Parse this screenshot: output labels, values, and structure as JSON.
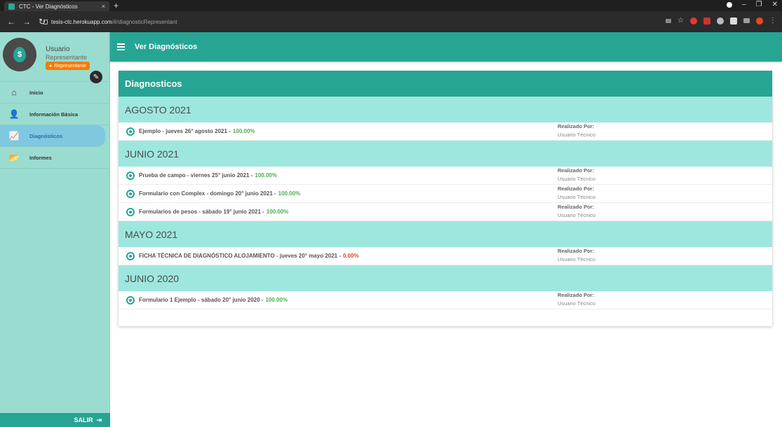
{
  "browser": {
    "tab_title": "CTC - Ver Diagnósticos",
    "tab_close": "×",
    "new_tab": "+",
    "url_host": "tesis-ctc.herokuapp.com",
    "url_path": "/#/diagnosticRepresentant"
  },
  "profile": {
    "name": "Usuario",
    "role": "Representante",
    "badge": "Representante"
  },
  "sidebar": {
    "items": [
      {
        "label": "Inicio",
        "icon": "home-icon",
        "glyph": "⌂"
      },
      {
        "label": "Información Básica",
        "icon": "user-add-icon",
        "glyph": "👤"
      },
      {
        "label": "Diagnósticos",
        "icon": "diagnostic-chart-icon",
        "glyph": "📈"
      },
      {
        "label": "Informes",
        "icon": "folder-open-icon",
        "glyph": "📂"
      }
    ],
    "logout_label": "SALIR"
  },
  "appbar": {
    "title": "Ver Diagnósticos"
  },
  "card": {
    "title": "Diagnosticos"
  },
  "groups": [
    {
      "month": "AGOSTO 2021",
      "items": [
        {
          "title": "Ejemplo - jueves 26° agosto 2021 -",
          "percent": "100.00%",
          "status": "ok",
          "by_label": "Realizado Por:",
          "by_value": "Usuario Técnico"
        }
      ]
    },
    {
      "month": "JUNIO 2021",
      "items": [
        {
          "title": "Prueba de campo - viernes 25° junio 2021 -",
          "percent": "100.00%",
          "status": "ok",
          "by_label": "Realizado Por:",
          "by_value": "Usuario Técnico"
        },
        {
          "title": "Formulario con Complex - domingo 20° junio 2021 -",
          "percent": "100.00%",
          "status": "ok",
          "by_label": "Realizado Por:",
          "by_value": "Usuario Técnico"
        },
        {
          "title": "Formularios de pesos - sábado 19° junio 2021 -",
          "percent": "100.00%",
          "status": "ok",
          "by_label": "Realizado Por:",
          "by_value": "Usuario Técnico"
        }
      ]
    },
    {
      "month": "MAYO 2021",
      "items": [
        {
          "title": "FICHA TÉCNICA DE DIAGNÓSTICO ALOJAMIENTO - jueves 20° mayo 2021 -",
          "percent": "0.00%",
          "status": "zero",
          "by_label": "Realizado Por:",
          "by_value": "Usuario Técnico"
        }
      ]
    },
    {
      "month": "JUNIO 2020",
      "items": [
        {
          "title": "Formulario 1 Ejemplo - sábado 20° junio 2020 -",
          "percent": "100.00%",
          "status": "ok",
          "by_label": "Realizado Por:",
          "by_value": "Usuario Técnico"
        }
      ]
    }
  ],
  "colors": {
    "primary": "#27a594",
    "group_bg": "#9ee7df",
    "ok": "#4caf50",
    "zero": "#e53935",
    "badge": "#f57c00"
  }
}
